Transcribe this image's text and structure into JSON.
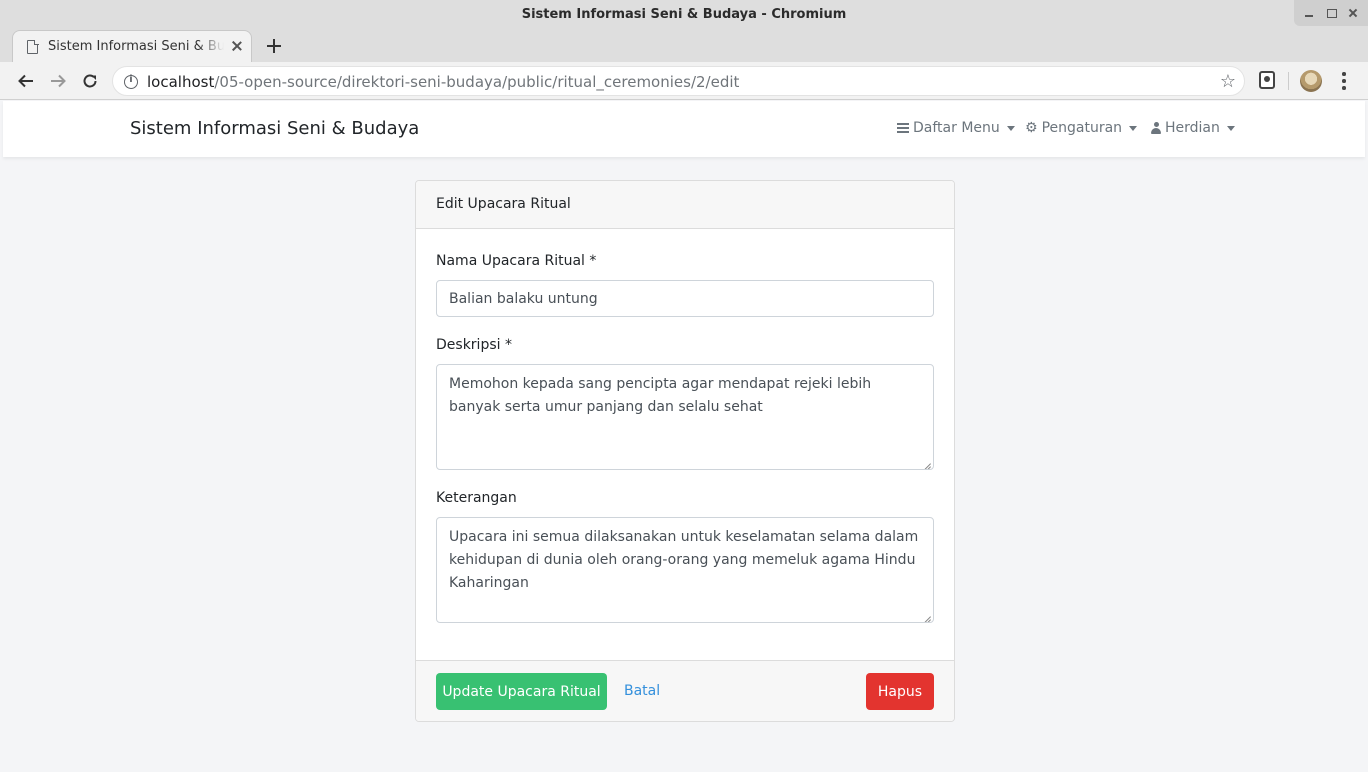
{
  "window": {
    "title": "Sistem Informasi Seni & Budaya - Chromium"
  },
  "tab": {
    "title": "Sistem Informasi Seni & Budaya"
  },
  "address_bar": {
    "host": "localhost",
    "path": "/05-open-source/direktori-seni-budaya/public/ritual_ceremonies/2/edit"
  },
  "navbar": {
    "brand": "Sistem Informasi Seni & Budaya",
    "menu": [
      {
        "label": "Daftar Menu",
        "icon": "bars-icon"
      },
      {
        "label": "Pengaturan",
        "icon": "cogs-icon"
      },
      {
        "label": "Herdian",
        "icon": "user-icon"
      }
    ]
  },
  "card": {
    "title": "Edit Upacara Ritual",
    "fields": {
      "name": {
        "label": "Nama Upacara Ritual *",
        "value": "Balian balaku untung"
      },
      "description": {
        "label": "Deskripsi *",
        "value": "Memohon kepada sang pencipta agar mendapat rejeki lebih banyak serta umur panjang dan selalu sehat"
      },
      "notes": {
        "label": "Keterangan",
        "value": "Upacara ini semua dilaksanakan untuk keselamatan selama dalam kehidupan di dunia oleh orang-orang yang memeluk agama Hindu Kaharingan"
      }
    },
    "buttons": {
      "update": "Update Upacara Ritual",
      "cancel": "Batal",
      "delete": "Hapus"
    }
  },
  "colors": {
    "success": "#38c172",
    "danger": "#e3342f",
    "link": "#3490dc",
    "body_bg": "#f4f5f7"
  }
}
